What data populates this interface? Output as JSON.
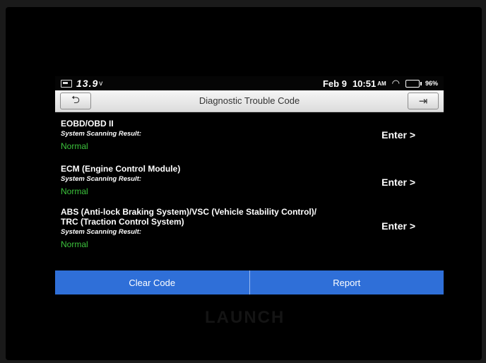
{
  "status_bar": {
    "voltage": "13.9",
    "voltage_unit": "v",
    "date": "Feb 9",
    "time": "10:51",
    "ampm": "AM",
    "battery_percent": "96%"
  },
  "header": {
    "title": "Diagnostic Trouble Code"
  },
  "results": [
    {
      "name": "EOBD/OBD II",
      "result_label": "System Scanning Result:",
      "status": "Normal",
      "action": "Enter >"
    },
    {
      "name": "ECM (Engine Control Module)",
      "result_label": "System Scanning Result:",
      "status": "Normal",
      "action": "Enter >"
    },
    {
      "name_line1": "ABS (Anti-lock Braking System)/VSC (Vehicle Stability Control)/",
      "name_line2": "TRC (Traction Control System)",
      "result_label": "System Scanning Result:",
      "status": "Normal",
      "action": "Enter >"
    }
  ],
  "footer": {
    "clear_code_label": "Clear Code",
    "report_label": "Report"
  },
  "device": {
    "brand_logo": "LAUNCH"
  },
  "colors": {
    "accent_blue": "#2f6fd8",
    "normal_green": "#3cc33c"
  },
  "icons": {
    "back": "back-arrow-icon",
    "exit": "exit-icon",
    "wifi": "wifi-icon",
    "battery": "battery-icon"
  }
}
